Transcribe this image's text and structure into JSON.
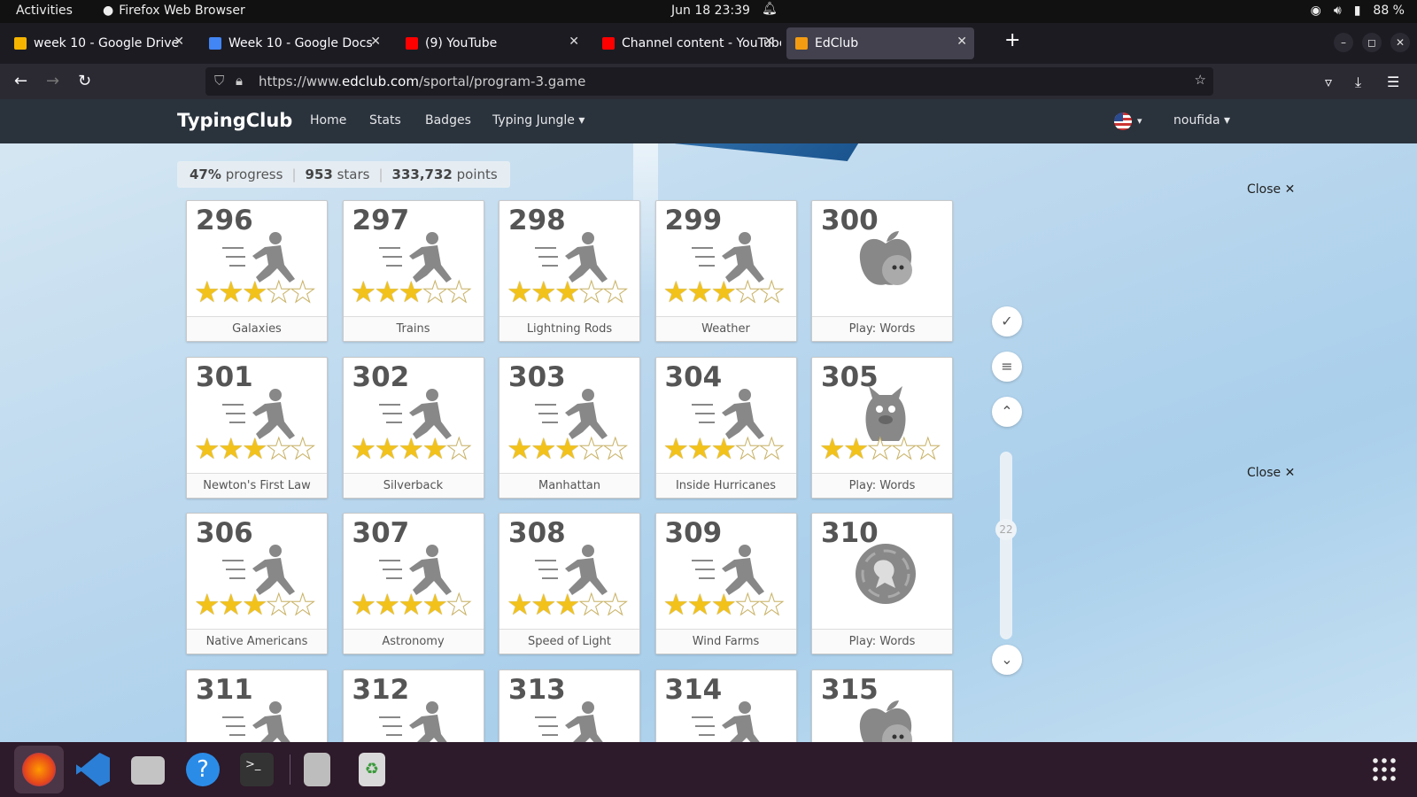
{
  "topbar": {
    "activities": "Activities",
    "app": "Firefox Web Browser",
    "clock": "Jun 18  23:39",
    "battery": "88 %"
  },
  "tabs": [
    {
      "title": "week 10 - Google Drive",
      "color": "#f4b400"
    },
    {
      "title": "Week 10 - Google Docs",
      "color": "#4285f4"
    },
    {
      "title": "(9) YouTube",
      "color": "#ff0000"
    },
    {
      "title": "Channel content - YouTube",
      "color": "#ff0000"
    },
    {
      "title": "EdClub",
      "color": "#f39c12"
    }
  ],
  "url": {
    "prefix": "https://www.",
    "host": "edclub.com",
    "path": "/sportal/program-3.game"
  },
  "site": {
    "brand": "TypingClub",
    "menu": [
      "Home",
      "Stats",
      "Badges",
      "Typing Jungle"
    ],
    "user": "noufida"
  },
  "stats": {
    "progress": "47%",
    "progress_label": "progress",
    "stars": "953",
    "stars_label": "stars",
    "points": "333,732",
    "points_label": "points"
  },
  "lessons": [
    {
      "num": "296",
      "name": "Galaxies",
      "kind": "runner",
      "stars": 3
    },
    {
      "num": "297",
      "name": "Trains",
      "kind": "runner",
      "stars": 3
    },
    {
      "num": "298",
      "name": "Lightning Rods",
      "kind": "runner",
      "stars": 3
    },
    {
      "num": "299",
      "name": "Weather",
      "kind": "runner",
      "stars": 3
    },
    {
      "num": "300",
      "name": "Play: Words",
      "kind": "apple",
      "stars": 0
    },
    {
      "num": "301",
      "name": "Newton's First Law",
      "kind": "runner",
      "stars": 3
    },
    {
      "num": "302",
      "name": "Silverback",
      "kind": "runner",
      "stars": 4
    },
    {
      "num": "303",
      "name": "Manhattan",
      "kind": "runner",
      "stars": 3
    },
    {
      "num": "304",
      "name": "Inside Hurricanes",
      "kind": "runner",
      "stars": 3
    },
    {
      "num": "305",
      "name": "Play: Words",
      "kind": "monster",
      "stars": 2
    },
    {
      "num": "306",
      "name": "Native Americans",
      "kind": "runner",
      "stars": 3
    },
    {
      "num": "307",
      "name": "Astronomy",
      "kind": "runner",
      "stars": 4
    },
    {
      "num": "308",
      "name": "Speed of Light",
      "kind": "runner",
      "stars": 3
    },
    {
      "num": "309",
      "name": "Wind Farms",
      "kind": "runner",
      "stars": 3
    },
    {
      "num": "310",
      "name": "Play: Words",
      "kind": "coin",
      "stars": 0
    },
    {
      "num": "311",
      "name": "",
      "kind": "runner",
      "stars": 0
    },
    {
      "num": "312",
      "name": "",
      "kind": "runner",
      "stars": 0
    },
    {
      "num": "313",
      "name": "",
      "kind": "runner",
      "stars": 0
    },
    {
      "num": "314",
      "name": "",
      "kind": "runner",
      "stars": 0
    },
    {
      "num": "315",
      "name": "",
      "kind": "apple",
      "stars": 0
    }
  ],
  "scroll": {
    "page": "22"
  },
  "close_label": "Close ✕"
}
